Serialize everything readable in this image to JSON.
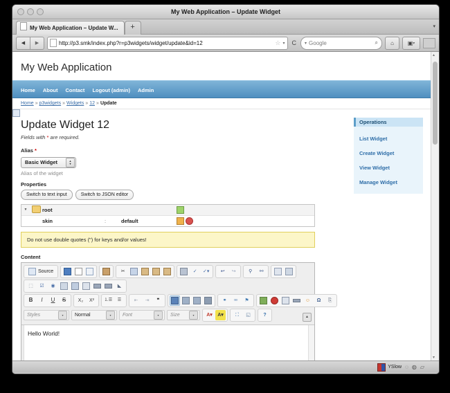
{
  "browser": {
    "window_title": "My Web Application – Update Widget",
    "tab": {
      "title": "My Web Application – Update W...",
      "favicon": "page-icon"
    },
    "new_tab_label": "+",
    "tab_list_arrow": "▾",
    "back_label": "◀",
    "forward_label": "▶",
    "url": "http://p3.smk/index.php?r=p3widgets/widget/update&id=12",
    "star_icon": "☆",
    "star_caret": "▾",
    "reload_label": "C",
    "search": {
      "engine_caret": "▾",
      "placeholder": "Google",
      "magnifier": "⌕"
    },
    "home_icon": "⌂",
    "bookmarks_icon": "▣",
    "bookmarks_caret": "▾",
    "reader_icon": "▤",
    "statusbar": {
      "yslow_label": "YSlow",
      "icon1": "◌",
      "icon2": "◍",
      "icon3": "▱"
    }
  },
  "site": {
    "title": "My Web Application",
    "menu": [
      {
        "label": "Home"
      },
      {
        "label": "About"
      },
      {
        "label": "Contact"
      },
      {
        "label": "Logout (admin)"
      },
      {
        "label": "Admin"
      }
    ],
    "breadcrumb": {
      "links": [
        {
          "label": "Home"
        },
        {
          "label": "p3widgets"
        },
        {
          "label": "Widgets"
        },
        {
          "label": "12"
        }
      ],
      "separator": "»",
      "current": "Update"
    }
  },
  "main": {
    "page_title": "Update Widget 12",
    "required_hint_before": "Fields with ",
    "required_marker": "*",
    "required_hint_after": " are required.",
    "alias": {
      "label": "Alias",
      "required_marker": "*",
      "selected": "Basic Widget",
      "help": "Alias of the widget"
    },
    "properties": {
      "label": "Properties",
      "buttons": [
        {
          "label": "Switch to text input"
        },
        {
          "label": "Switch to JSON editor"
        }
      ],
      "tree": {
        "root": {
          "toggle": "▼",
          "icon": "folder-icon",
          "name": "root",
          "actions": [
            "add-folder-icon",
            "add-property-icon"
          ]
        },
        "rows": [
          {
            "icon": "property-icon",
            "key": "skin",
            "colon": ":",
            "value": "default",
            "actions": [
              "add-folder-icon",
              "add-property-icon",
              "delete-icon"
            ]
          }
        ]
      },
      "warning": "Do not use double quotes (\") for keys and/or values!"
    },
    "content": {
      "label": "Content",
      "editor": {
        "body_text": "Hello World!",
        "collapse_icon": "▲",
        "toolbar": {
          "row1": [
            {
              "group": [
                {
                  "name": "source-button",
                  "glyph": "▤",
                  "label": "Source"
                }
              ]
            },
            {
              "group": [
                {
                  "name": "save-icon",
                  "glyph": "▣"
                },
                {
                  "name": "new-page-icon",
                  "glyph": "▢"
                },
                {
                  "name": "preview-icon",
                  "glyph": "◱"
                }
              ]
            },
            {
              "group": [
                {
                  "name": "templates-icon",
                  "glyph": "▦"
                }
              ]
            },
            {
              "group": [
                {
                  "name": "cut-icon",
                  "glyph": "✂"
                },
                {
                  "name": "copy-icon",
                  "glyph": "❏"
                },
                {
                  "name": "paste-icon",
                  "glyph": "▩"
                },
                {
                  "name": "paste-text-icon",
                  "glyph": "▨"
                },
                {
                  "name": "paste-word-icon",
                  "glyph": "▧"
                }
              ]
            },
            {
              "group": [
                {
                  "name": "print-icon",
                  "glyph": "⎙"
                },
                {
                  "name": "spellcheck-icon",
                  "glyph": "✓"
                },
                {
                  "name": "spellcheck-menu-icon",
                  "glyph": "✓▾"
                }
              ]
            },
            {
              "group": [
                {
                  "name": "undo-icon",
                  "glyph": "↩"
                },
                {
                  "name": "redo-icon",
                  "glyph": "↪"
                }
              ]
            },
            {
              "group": [
                {
                  "name": "find-icon",
                  "glyph": "⚲"
                },
                {
                  "name": "replace-icon",
                  "glyph": "⚯"
                }
              ]
            },
            {
              "group": [
                {
                  "name": "select-all-icon",
                  "glyph": "▣"
                },
                {
                  "name": "remove-format-icon",
                  "glyph": "◨"
                }
              ]
            }
          ],
          "row2": [
            {
              "group": [
                {
                  "name": "form-icon",
                  "glyph": "⬚"
                },
                {
                  "name": "checkbox-icon",
                  "glyph": "☑"
                },
                {
                  "name": "radio-icon",
                  "glyph": "◉"
                },
                {
                  "name": "text-field-icon",
                  "glyph": "▭"
                },
                {
                  "name": "textarea-icon",
                  "glyph": "▤"
                },
                {
                  "name": "select-field-icon",
                  "glyph": "▥"
                },
                {
                  "name": "button-icon",
                  "glyph": "▬"
                },
                {
                  "name": "image-button-icon",
                  "glyph": "▭"
                },
                {
                  "name": "hidden-field-icon",
                  "glyph": "◣"
                }
              ]
            }
          ],
          "row3": [
            {
              "group": [
                {
                  "name": "bold-icon",
                  "glyph": "B"
                },
                {
                  "name": "italic-icon",
                  "glyph": "I"
                },
                {
                  "name": "underline-icon",
                  "glyph": "U"
                },
                {
                  "name": "strike-icon",
                  "glyph": "S"
                }
              ]
            },
            {
              "group": [
                {
                  "name": "subscript-icon",
                  "glyph": "X₂"
                },
                {
                  "name": "superscript-icon",
                  "glyph": "X²"
                }
              ]
            },
            {
              "group": [
                {
                  "name": "numbered-list-icon",
                  "glyph": "⒈"
                },
                {
                  "name": "bulleted-list-icon",
                  "glyph": "☰"
                }
              ]
            },
            {
              "group": [
                {
                  "name": "outdent-icon",
                  "glyph": "⇤"
                },
                {
                  "name": "indent-icon",
                  "glyph": "⇥"
                },
                {
                  "name": "blockquote-icon",
                  "glyph": "❞"
                }
              ]
            },
            {
              "group": [
                {
                  "name": "align-left-icon",
                  "glyph": "▤",
                  "active": true
                },
                {
                  "name": "align-center-icon",
                  "glyph": "▥"
                },
                {
                  "name": "align-right-icon",
                  "glyph": "▦"
                },
                {
                  "name": "justify-icon",
                  "glyph": "▩"
                }
              ]
            },
            {
              "group": [
                {
                  "name": "link-icon",
                  "glyph": "⚭"
                },
                {
                  "name": "unlink-icon",
                  "glyph": "⚮"
                },
                {
                  "name": "anchor-icon",
                  "glyph": "⚑"
                }
              ]
            },
            {
              "group": [
                {
                  "name": "image-icon",
                  "glyph": "▣"
                },
                {
                  "name": "flash-icon",
                  "glyph": "◍"
                },
                {
                  "name": "table-icon",
                  "glyph": "▦"
                },
                {
                  "name": "horizontal-rule-icon",
                  "glyph": "▬"
                },
                {
                  "name": "smiley-icon",
                  "glyph": "☺"
                },
                {
                  "name": "special-char-icon",
                  "glyph": "Ω"
                },
                {
                  "name": "page-break-icon",
                  "glyph": "⎘"
                }
              ]
            }
          ],
          "row4": [
            {
              "name": "styles-dropdown",
              "label": "Styles",
              "caret": "▾"
            },
            {
              "name": "format-dropdown",
              "label": "Normal",
              "caret": "▾"
            },
            {
              "name": "font-dropdown",
              "label": "Font",
              "caret": "▾"
            },
            {
              "name": "size-dropdown",
              "label": "Size",
              "caret": "▾"
            },
            {
              "name": "text-color-icon",
              "glyph": "A",
              "caret": "▾"
            },
            {
              "name": "background-color-icon",
              "glyph": "A",
              "caret": "▾"
            },
            {
              "name": "maximize-icon",
              "glyph": "⛶"
            },
            {
              "name": "show-blocks-icon",
              "glyph": "◱"
            },
            {
              "name": "about-icon",
              "glyph": "?"
            }
          ]
        }
      }
    },
    "operations": {
      "title": "Operations",
      "items": [
        {
          "label": "List Widget"
        },
        {
          "label": "Create Widget"
        },
        {
          "label": "View Widget"
        },
        {
          "label": "Manage Widget"
        }
      ]
    }
  },
  "colors": {
    "nav_blue": "#4f8fc0",
    "link_blue": "#3b6ea8",
    "warn_bg": "#fcf6c8",
    "panel_bg": "#e9f4fb",
    "required_red": "#cc0000"
  }
}
